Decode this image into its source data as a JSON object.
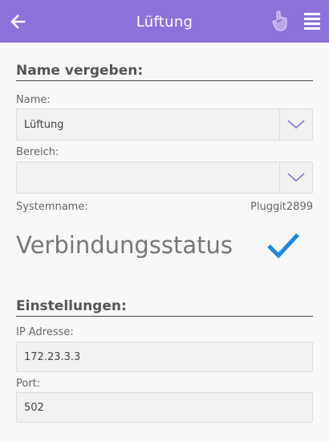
{
  "header": {
    "title": "Lüftung",
    "bg_color": "#8c72d8",
    "back_icon": "arrow-left-icon",
    "hand_icon": "hand-pointer-icon",
    "menu_icon": "menu-icon"
  },
  "name_section": {
    "title": "Name vergeben:",
    "name_label": "Name:",
    "name_value": "Lüftung",
    "bereich_label": "Bereich:",
    "bereich_value": "",
    "dropdown_icon": "chevron-down-icon",
    "systemname_label": "Systemname:",
    "systemname_value": "Pluggit2899"
  },
  "status": {
    "label": "Verbindungsstatus",
    "icon": "checkmark-icon",
    "color": "#1e88e5"
  },
  "settings_section": {
    "title": "Einstellungen:",
    "ip_label": "IP Adresse:",
    "ip_value": "172.23.3.3",
    "port_label": "Port:",
    "port_value": "502"
  }
}
